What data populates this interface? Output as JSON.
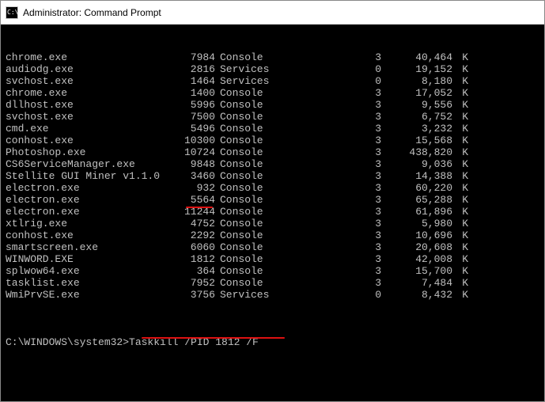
{
  "window": {
    "title": "Administrator: Command Prompt"
  },
  "processes": [
    {
      "name": "chrome.exe",
      "pid": "7984",
      "session": "Console",
      "snum": "3",
      "mem": "40,464",
      "unit": "K"
    },
    {
      "name": "audiodg.exe",
      "pid": "2816",
      "session": "Services",
      "snum": "0",
      "mem": "19,152",
      "unit": "K"
    },
    {
      "name": "svchost.exe",
      "pid": "1464",
      "session": "Services",
      "snum": "0",
      "mem": "8,180",
      "unit": "K"
    },
    {
      "name": "chrome.exe",
      "pid": "1400",
      "session": "Console",
      "snum": "3",
      "mem": "17,052",
      "unit": "K"
    },
    {
      "name": "dllhost.exe",
      "pid": "5996",
      "session": "Console",
      "snum": "3",
      "mem": "9,556",
      "unit": "K"
    },
    {
      "name": "svchost.exe",
      "pid": "7500",
      "session": "Console",
      "snum": "3",
      "mem": "6,752",
      "unit": "K"
    },
    {
      "name": "cmd.exe",
      "pid": "5496",
      "session": "Console",
      "snum": "3",
      "mem": "3,232",
      "unit": "K"
    },
    {
      "name": "conhost.exe",
      "pid": "10300",
      "session": "Console",
      "snum": "3",
      "mem": "15,568",
      "unit": "K"
    },
    {
      "name": "Photoshop.exe",
      "pid": "10724",
      "session": "Console",
      "snum": "3",
      "mem": "438,820",
      "unit": "K"
    },
    {
      "name": "CS6ServiceManager.exe",
      "pid": "9848",
      "session": "Console",
      "snum": "3",
      "mem": "9,036",
      "unit": "K"
    },
    {
      "name": "Stellite GUI Miner v1.1.0",
      "pid": "3460",
      "session": "Console",
      "snum": "3",
      "mem": "14,388",
      "unit": "K"
    },
    {
      "name": "electron.exe",
      "pid": "932",
      "session": "Console",
      "snum": "3",
      "mem": "60,220",
      "unit": "K"
    },
    {
      "name": "electron.exe",
      "pid": "5564",
      "session": "Console",
      "snum": "3",
      "mem": "65,288",
      "unit": "K"
    },
    {
      "name": "electron.exe",
      "pid": "11244",
      "session": "Console",
      "snum": "3",
      "mem": "61,896",
      "unit": "K"
    },
    {
      "name": "xtlrig.exe",
      "pid": "4752",
      "session": "Console",
      "snum": "3",
      "mem": "5,980",
      "unit": "K"
    },
    {
      "name": "conhost.exe",
      "pid": "2292",
      "session": "Console",
      "snum": "3",
      "mem": "10,696",
      "unit": "K"
    },
    {
      "name": "smartscreen.exe",
      "pid": "6060",
      "session": "Console",
      "snum": "3",
      "mem": "20,608",
      "unit": "K"
    },
    {
      "name": "WINWORD.EXE",
      "pid": "1812",
      "session": "Console",
      "snum": "3",
      "mem": "42,008",
      "unit": "K"
    },
    {
      "name": "splwow64.exe",
      "pid": "364",
      "session": "Console",
      "snum": "3",
      "mem": "15,700",
      "unit": "K"
    },
    {
      "name": "tasklist.exe",
      "pid": "7952",
      "session": "Console",
      "snum": "3",
      "mem": "7,484",
      "unit": "K"
    },
    {
      "name": "WmiPrvSE.exe",
      "pid": "3756",
      "session": "Services",
      "snum": "0",
      "mem": "8,432",
      "unit": "K"
    }
  ],
  "prompt": {
    "path": "C:\\WINDOWS\\system32>",
    "command": "Taskkill /PID 1812 /F"
  }
}
